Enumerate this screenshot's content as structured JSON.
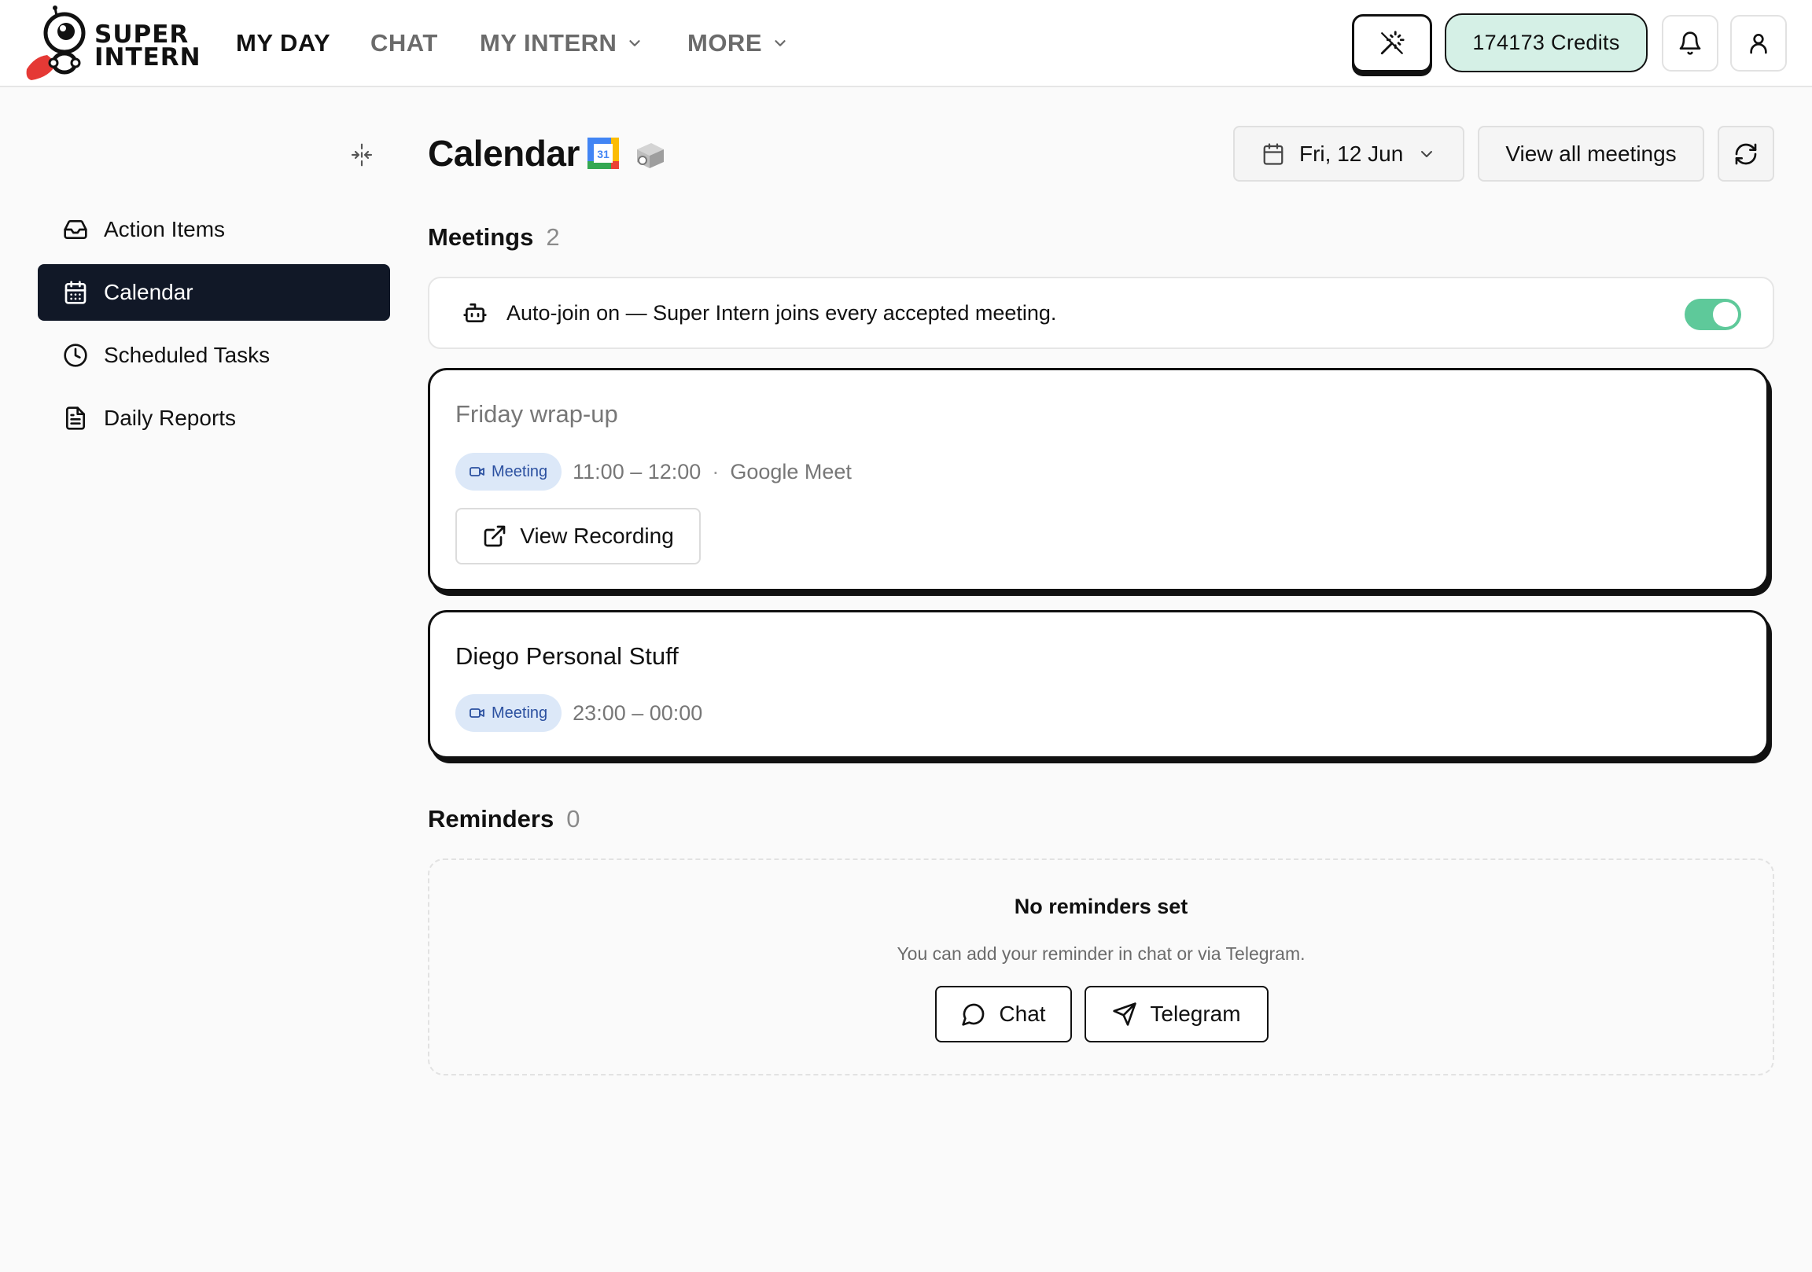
{
  "brand": {
    "line1": "SUPER",
    "line2": "INTERN"
  },
  "nav": {
    "my_day": "MY DAY",
    "chat": "CHAT",
    "my_intern": "MY INTERN",
    "more": "MORE"
  },
  "header": {
    "credits": "174173 Credits"
  },
  "sidebar": {
    "items": [
      {
        "label": "Action Items",
        "icon": "inbox-icon"
      },
      {
        "label": "Calendar",
        "icon": "calendar-icon",
        "active": true
      },
      {
        "label": "Scheduled Tasks",
        "icon": "clock-icon"
      },
      {
        "label": "Daily Reports",
        "icon": "file-text-icon"
      }
    ]
  },
  "page": {
    "title": "Calendar",
    "date": "Fri, 12 Jun",
    "view_all": "View all meetings"
  },
  "meetings": {
    "label": "Meetings",
    "count": "2",
    "autojoin_text": "Auto-join on — Super Intern joins every accepted meeting.",
    "autojoin_enabled": true,
    "items": [
      {
        "title": "Friday wrap-up",
        "badge": "Meeting",
        "time": "11:00 – 12:00",
        "separator": "·",
        "location": "Google Meet",
        "action": "View Recording"
      },
      {
        "title": "Diego Personal Stuff",
        "badge": "Meeting",
        "time": "23:00 – 00:00"
      }
    ]
  },
  "reminders": {
    "label": "Reminders",
    "count": "0",
    "empty_title": "No reminders set",
    "empty_sub": "You can add your reminder in chat or via Telegram.",
    "chat_button": "Chat",
    "telegram_button": "Telegram"
  },
  "colors": {
    "accent_dark": "#111827",
    "credits_bg": "#d5f0e6",
    "toggle_on": "#5ec99a",
    "badge_bg": "#dce8f8",
    "badge_text": "#2b50a0",
    "logo_cape": "#e53935"
  }
}
